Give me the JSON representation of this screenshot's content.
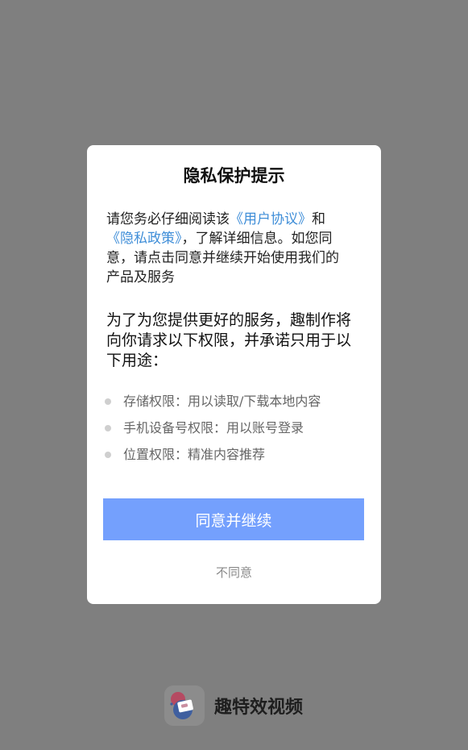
{
  "dialog": {
    "title": "隐私保护提示",
    "intro": {
      "prefix": "请您务必仔细阅读该",
      "user_agreement_link": "《用户协议》",
      "middle": "和",
      "privacy_policy_link": "《隐私政策》",
      "suffix": "，了解详细信息。如您同意，请点击同意并继续开始使用我们的产品及服务"
    },
    "permissions_intro": "为了为您提供更好的服务，趣制作将向你请求以下权限，并承诺只用于以下用途：",
    "permissions": [
      "存储权限：用以读取/下载本地内容",
      "手机设备号权限：用以账号登录",
      "位置权限：精准内容推荐"
    ],
    "agree_label": "同意并继续",
    "disagree_label": "不同意"
  },
  "brand": {
    "name": "趣特效视频",
    "logo_icon": "video-camera-logo-icon"
  },
  "colors": {
    "overlay": "#7f7f7f",
    "link": "#3f8ed8",
    "primary_button": "#74a0fd"
  }
}
